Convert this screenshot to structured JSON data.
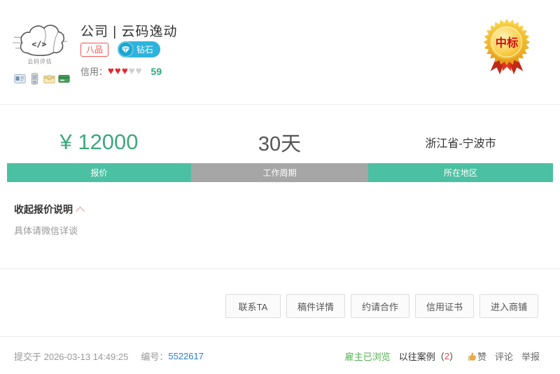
{
  "header": {
    "title": "公司 | 云码逸动",
    "avatar_caption": "云码评估",
    "avatar_code_glyph": "</>",
    "rank_badge": "八品",
    "diamond_badge": "钻石",
    "credit_label": "信用：",
    "hearts_filled": 3,
    "hearts_total": 5,
    "credit_score": "59",
    "award_badge": "中标"
  },
  "stats": {
    "price_value": "¥ 12000",
    "price_label": "报价",
    "duration_value": "30天",
    "duration_label": "工作周期",
    "region_value": "浙江省-宁波市",
    "region_label": "所在地区"
  },
  "quote": {
    "toggle_label": "收起报价说明",
    "description": "具体请微信详谈"
  },
  "actions": {
    "buttons": [
      "联系TA",
      "稿件详情",
      "约请合作",
      "信用证书",
      "进入商铺"
    ]
  },
  "footer": {
    "submitted_text": "提交于 2026-03-13 14:49:25",
    "number_label": "编号：",
    "number_value": "5522617",
    "employer_viewed": "雇主已浏览",
    "past_cases_prefix": "以往案例（",
    "past_cases_count": "2",
    "past_cases_suffix": "）",
    "like_label": "赞",
    "comment_label": "评论",
    "report_label": "举报"
  },
  "icons": {
    "verifications": [
      "idcard-icon",
      "phone-icon",
      "email-icon",
      "bankcard-icon"
    ],
    "diamond": "diamond-icon",
    "hearts": "heart-icon",
    "collapse": "chevron-up-icon",
    "like": "thumb-up-icon",
    "medal": "gold-medal-icon"
  },
  "colors": {
    "accent_green": "#4cc0a2",
    "bar_gray": "#a6a6a6",
    "price_green": "#3fa87e",
    "heart_red": "#e8252a",
    "heart_gray": "#cfcfcf",
    "rank_red": "#f05353",
    "diamond_blue": "#2cb3dd",
    "score_green": "#2fa97c",
    "link_blue": "#2a7ed3",
    "viewed_green": "#52b152",
    "count_red": "#e64340"
  }
}
